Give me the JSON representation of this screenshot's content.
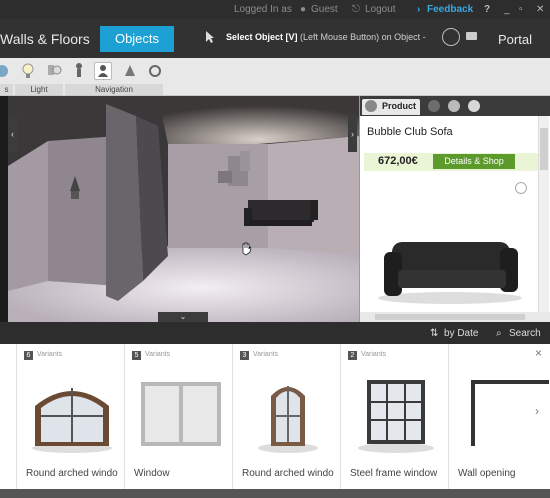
{
  "topbar": {
    "logged_in_as": "Logged In as",
    "guest": "Guest",
    "logout": "Logout",
    "feedback": "Feedback",
    "help": "?",
    "window_controls": [
      "_",
      "▫",
      "✕"
    ]
  },
  "nav": {
    "walls_floors": "Walls & Floors",
    "objects": "Objects",
    "select_object": "Select Object [V]",
    "select_hint": "(Left Mouse Button) on Object -",
    "portal": "Portal"
  },
  "toolbar": {
    "groups": [
      "s",
      "Light",
      "Navigation"
    ]
  },
  "product": {
    "tab_label": "Product",
    "name": "Bubble Club Sofa",
    "price": "672,00€",
    "shop_button": "Details & Shop"
  },
  "sortbar": {
    "by_date": "by Date",
    "search": "Search"
  },
  "catalog": {
    "close": "×",
    "items": [
      {
        "count": "6",
        "variants": "Variants",
        "name": "Round arched windo"
      },
      {
        "count": "5",
        "variants": "Variants",
        "name": "Window"
      },
      {
        "count": "3",
        "variants": "Variants",
        "name": "Round arched windo"
      },
      {
        "count": "2",
        "variants": "Variants",
        "name": "Steel frame window"
      },
      {
        "count": "",
        "variants": "",
        "name": "Wall opening"
      }
    ]
  },
  "colors": {
    "accent": "#1da0d3",
    "shop": "#5c9a2c",
    "feedback": "#3aa6e0"
  }
}
